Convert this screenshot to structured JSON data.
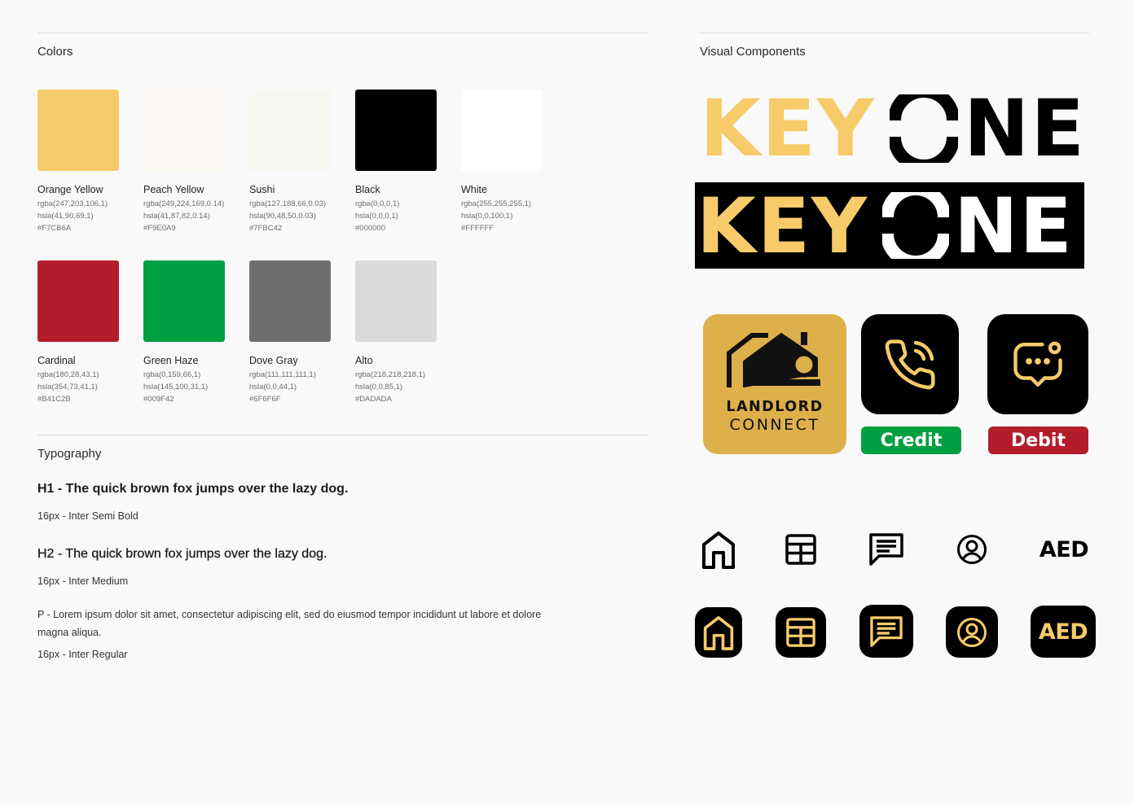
{
  "colors_section": {
    "title": "Colors",
    "swatches": [
      {
        "name": "Orange Yellow",
        "rgba": "rgba(247,203,106,1)",
        "hsla": "hsla(41,90,69,1)",
        "hex": "#F7CB6A",
        "fill": "#F7CB6A"
      },
      {
        "name": "Peach Yellow",
        "rgba": "rgba(249,224,169,0.14)",
        "hsla": "hsla(41,87,82,0.14)",
        "hex": "#F9E0A9",
        "fill": "#FBF8F3"
      },
      {
        "name": "Sushi",
        "rgba": "rgba(127,188,66,0.03)",
        "hsla": "hsla(90,48,50,0.03)",
        "hex": "#7FBC42",
        "fill": "#F5F8F1"
      },
      {
        "name": "Black",
        "rgba": "rgba(0,0,0,1)",
        "hsla": "hsla(0,0,0,1)",
        "hex": "#000000",
        "fill": "#000000"
      },
      {
        "name": "White",
        "rgba": "rgba(255,255,255,1)",
        "hsla": "hsla(0,0,100,1)",
        "hex": "#FFFFFF",
        "fill": "#FFFFFF"
      },
      {
        "name": "Cardinal",
        "rgba": "rgba(180,28,43,1)",
        "hsla": "hsla(354,73,41,1)",
        "hex": "#B41C2B",
        "fill": "#B41C2B"
      },
      {
        "name": "Green Haze",
        "rgba": "rgba(0,159,66,1)",
        "hsla": "hsla(145,100,31,1)",
        "hex": "#009F42",
        "fill": "#009F42"
      },
      {
        "name": "Dove Gray",
        "rgba": "rgba(111,111,111,1)",
        "hsla": "hsla(0,0,44,1)",
        "hex": "#6F6F6F",
        "fill": "#6F6F6F"
      },
      {
        "name": "Alto",
        "rgba": "rgba(218,218,218,1)",
        "hsla": "hsla(0,0,85,1)",
        "hex": "#DADADA",
        "fill": "#DADADA"
      }
    ]
  },
  "typography_section": {
    "title": "Typography",
    "h1": {
      "sample": "H1 - The quick brown fox jumps over the lazy dog.",
      "spec": "16px - Inter Semi Bold"
    },
    "h2": {
      "sample": "H2 - The quick brown fox jumps over the lazy dog.",
      "spec": "16px - Inter Medium"
    },
    "p": {
      "sample": "P - Lorem ipsum dolor sit amet, consectetur adipiscing elit, sed do eiusmod tempor incididunt ut labore et dolore magna aliqua.",
      "spec": "16px - Inter Regular"
    }
  },
  "visual_section": {
    "title": "Visual Components",
    "logo": {
      "key": "KEY",
      "ne": "NE"
    },
    "app_icon": {
      "line1": "LANDLORD",
      "line2": "CONNECT"
    },
    "credit_label": "Credit",
    "debit_label": "Debit",
    "aed_label": "AED",
    "icons": [
      "home-icon",
      "table-icon",
      "message-icon",
      "user-icon",
      "phone-icon",
      "chat-icon"
    ]
  },
  "palette": {
    "brand": "#F7CB6A",
    "gold": "#DDB04A",
    "black": "#000000",
    "green": "#009F42",
    "red": "#B41C2B"
  }
}
